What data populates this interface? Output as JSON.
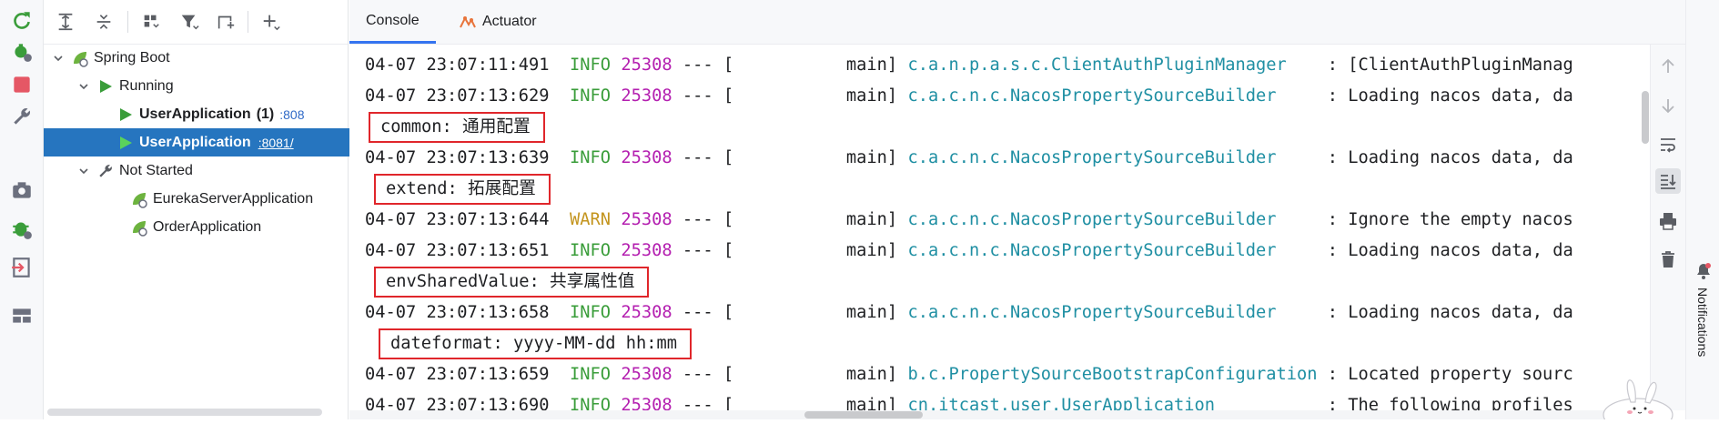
{
  "left_toolbar": {
    "icons": [
      "rerun-icon",
      "debug-settings-icon",
      "stop-icon",
      "wrench-icon",
      "camera-icon",
      "debug-bug-icon",
      "exit-icon",
      "layout-icon"
    ]
  },
  "services_toolbar": {
    "icons": [
      "expand-all-icon",
      "collapse-all-icon",
      "group-icon",
      "filter-icon",
      "new-service-icon",
      "add-icon"
    ]
  },
  "tree": {
    "root": "Spring Boot",
    "running_label": "Running",
    "apps_running": [
      {
        "name": "UserApplication",
        "count": "(1)",
        "port": ":808"
      },
      {
        "name": "UserApplication",
        "port": ":8081/"
      }
    ],
    "not_started_label": "Not Started",
    "apps_not_started": [
      "EurekaServerApplication",
      "OrderApplication"
    ]
  },
  "tabs": [
    {
      "label": "Console"
    },
    {
      "label": "Actuator"
    }
  ],
  "console": {
    "separator": "---",
    "bracket": "[",
    "thread": "main]",
    "lines": [
      {
        "ts": "04-07 23:07:11:491",
        "level": "INFO",
        "pid": "25308",
        "logger": "c.a.n.p.a.s.c.ClientAuthPluginManager",
        "msg": ": [ClientAuthPluginManag"
      },
      {
        "ts": "04-07 23:07:13:629",
        "level": "INFO",
        "pid": "25308",
        "logger": "c.a.c.n.c.NacosPropertySourceBuilder",
        "msg": ": Loading nacos data, da"
      },
      {
        "ts": "04-07 23:07:13:639",
        "level": "INFO",
        "pid": "25308",
        "logger": "c.a.c.n.c.NacosPropertySourceBuilder",
        "msg": ": Loading nacos data, da"
      },
      {
        "ts": "04-07 23:07:13:644",
        "level": "WARN",
        "pid": "25308",
        "logger": "c.a.c.n.c.NacosPropertySourceBuilder",
        "msg": ": Ignore the empty nacos"
      },
      {
        "ts": "04-07 23:07:13:651",
        "level": "INFO",
        "pid": "25308",
        "logger": "c.a.c.n.c.NacosPropertySourceBuilder",
        "msg": ": Loading nacos data, da"
      },
      {
        "ts": "04-07 23:07:13:658",
        "level": "INFO",
        "pid": "25308",
        "logger": "c.a.c.n.c.NacosPropertySourceBuilder",
        "msg": ": Loading nacos data, da"
      },
      {
        "ts": "04-07 23:07:13:659",
        "level": "INFO",
        "pid": "25308",
        "logger": "b.c.PropertySourceBootstrapConfiguration",
        "msg": ": Located property sourc"
      },
      {
        "ts": "04-07 23:07:13:690",
        "level": "INFO",
        "pid": "25308",
        "logger": "cn.itcast.user.UserApplication",
        "msg": ": The following profiles"
      }
    ],
    "highlights": [
      "common: 通用配置",
      "extend: 拓展配置",
      "envSharedValue: 共享属性值",
      "dateformat: yyyy-MM-dd hh:mm"
    ]
  },
  "right_toolbar": {
    "icons": [
      "scroll-up-icon",
      "scroll-down-icon",
      "soft-wrap-icon",
      "scroll-to-end-icon",
      "print-icon",
      "trash-icon"
    ]
  },
  "notifications": {
    "label": "Notifications"
  },
  "colors": {
    "selection": "#2675bf",
    "info": "#3a9d3a",
    "warn": "#c4951f",
    "pid": "#b41fb0",
    "logger": "#1f8fa3",
    "highlight_border": "#e0262b",
    "spring_green": "#6db33f"
  }
}
